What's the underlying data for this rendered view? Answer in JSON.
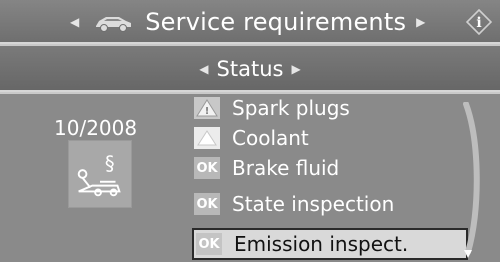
{
  "window": {
    "title": "Service requirements",
    "info_glyph": "i"
  },
  "status": {
    "label": "Status"
  },
  "summary": {
    "date": "10/2008",
    "section_glyph": "§"
  },
  "items": [
    {
      "label": "Spark plugs",
      "state": "warning",
      "badge": ""
    },
    {
      "label": "Coolant",
      "state": "warning-light",
      "badge": ""
    },
    {
      "label": "Brake fluid",
      "state": "ok",
      "badge": "OK"
    },
    {
      "label": "State inspection",
      "state": "ok",
      "badge": "OK"
    },
    {
      "label": "Emission inspect.",
      "state": "ok",
      "badge": "OK",
      "selected": true
    }
  ],
  "icons": [
    "arrow-left-icon",
    "car-icon",
    "arrow-right-icon",
    "info-icon",
    "service-icon",
    "warning-triangle-icon",
    "scroll-down-icon"
  ]
}
